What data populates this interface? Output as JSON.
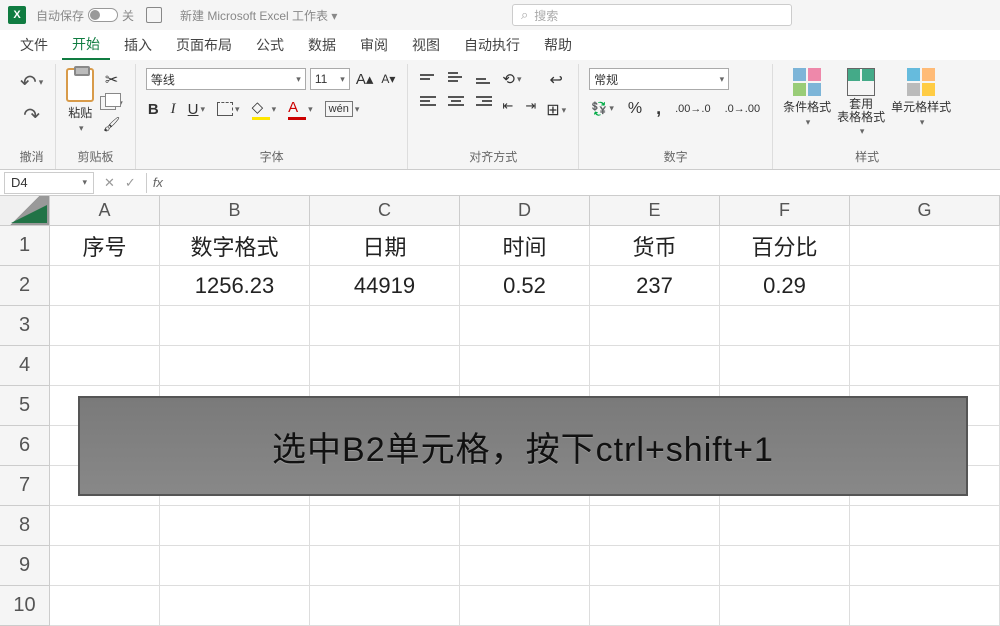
{
  "titlebar": {
    "app_short": "X",
    "autosave_label": "自动保存",
    "autosave_status": "关",
    "doc_title": "新建 Microsoft Excel 工作表 ▾",
    "search_placeholder": "搜索"
  },
  "tabs": [
    "文件",
    "开始",
    "插入",
    "页面布局",
    "公式",
    "数据",
    "审阅",
    "视图",
    "自动执行",
    "帮助"
  ],
  "active_tab": "开始",
  "ribbon": {
    "groups": [
      "撤消",
      "剪贴板",
      "字体",
      "对齐方式",
      "数字",
      "样式"
    ],
    "clipboard": {
      "paste": "粘贴"
    },
    "font": {
      "name": "等线",
      "size": "11"
    },
    "number": {
      "format": "常规"
    },
    "styles": {
      "conditional": "条件格式",
      "table": "套用\n表格格式",
      "cell": "单元格样式"
    }
  },
  "formula_bar": {
    "name_box": "D4",
    "formula": ""
  },
  "columns": [
    "A",
    "B",
    "C",
    "D",
    "E",
    "F",
    "G"
  ],
  "col_widths": [
    "cw-A",
    "cw-B",
    "cw-C",
    "cw-D",
    "cw-E",
    "cw-F",
    "cw-G"
  ],
  "rows": [
    "1",
    "2",
    "3",
    "4",
    "5",
    "6",
    "7",
    "8",
    "9",
    "10"
  ],
  "grid": [
    [
      "序号",
      "数字格式",
      "日期",
      "时间",
      "货币",
      "百分比",
      ""
    ],
    [
      "",
      "1256.23",
      "44919",
      "0.52",
      "237",
      "0.29",
      ""
    ],
    [
      "",
      "",
      "",
      "",
      "",
      "",
      ""
    ],
    [
      "",
      "",
      "",
      "",
      "",
      "",
      ""
    ],
    [
      "",
      "",
      "",
      "",
      "",
      "",
      ""
    ],
    [
      "",
      "",
      "",
      "",
      "",
      "",
      ""
    ],
    [
      "",
      "",
      "",
      "",
      "",
      "",
      ""
    ],
    [
      "",
      "",
      "",
      "",
      "",
      "",
      ""
    ],
    [
      "",
      "",
      "",
      "",
      "",
      "",
      ""
    ],
    [
      "",
      "",
      "",
      "",
      "",
      "",
      ""
    ]
  ],
  "instruction": "选中B2单元格，按下ctrl+shift+1"
}
